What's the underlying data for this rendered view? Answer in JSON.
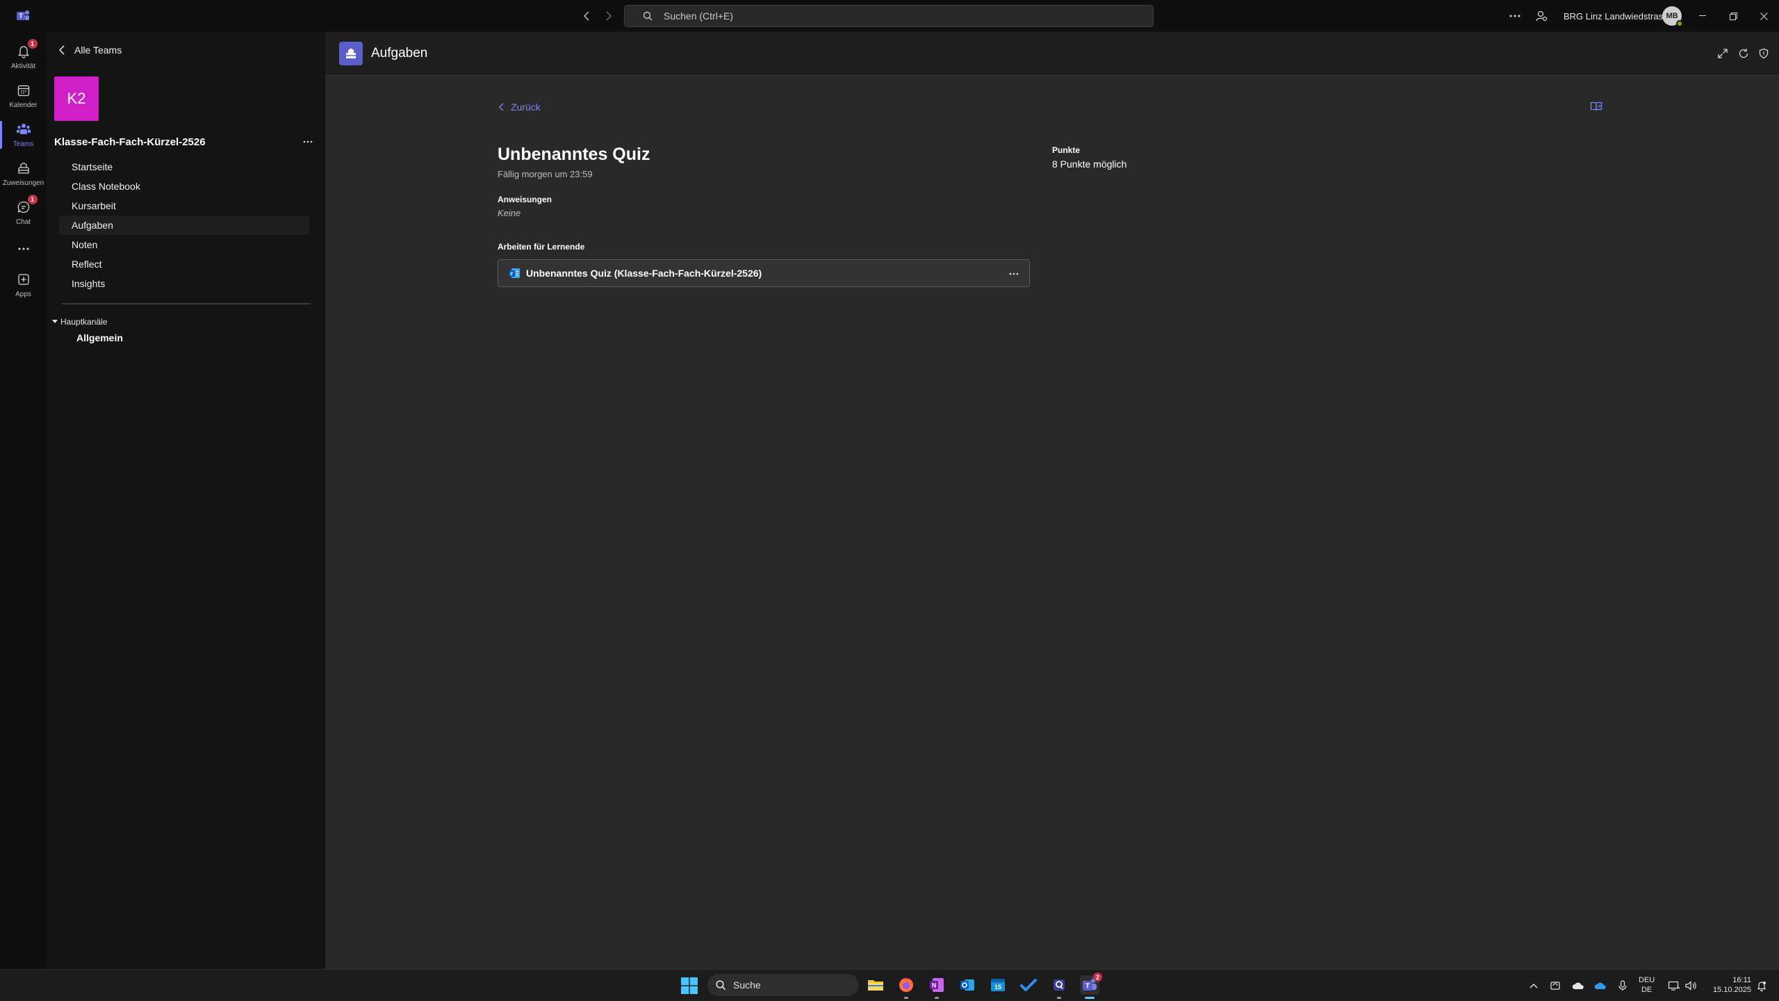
{
  "titlebar": {
    "search_placeholder": "Suchen (Ctrl+E)",
    "org_name": "BRG Linz Landwiedstrasse",
    "avatar_initials": "MB"
  },
  "rail": {
    "items": [
      {
        "label": "Aktivität",
        "icon": "bell-icon",
        "badge": "1"
      },
      {
        "label": "Kalender",
        "icon": "calendar-icon"
      },
      {
        "label": "Teams",
        "icon": "teams-icon",
        "active": true
      },
      {
        "label": "Zuweisungen",
        "icon": "assignments-icon"
      },
      {
        "label": "Chat",
        "icon": "chat-icon",
        "badge": "1"
      },
      {
        "label": "Apps",
        "icon": "apps-icon"
      }
    ]
  },
  "team": {
    "back_label": "Alle Teams",
    "tile_initials": "K2",
    "tile_color": "#d11fc7",
    "name": "Klasse-Fach-Fach-Kürzel-2526",
    "nav": [
      "Startseite",
      "Class Notebook",
      "Kursarbeit",
      "Aufgaben",
      "Noten",
      "Reflect",
      "Insights"
    ],
    "selected_nav": "Aufgaben",
    "channels_header": "Hauptkanäle",
    "channel": "Allgemein"
  },
  "app": {
    "title": "Aufgaben",
    "accent": "#5b5fc7"
  },
  "assignment": {
    "back_label": "Zurück",
    "title": "Unbenanntes Quiz",
    "due": "Fällig morgen um 23:59",
    "instructions_label": "Anweisungen",
    "instructions_value": "Keine",
    "work_label": "Arbeiten für Lernende",
    "work_item": "Unbenanntes Quiz (Klasse-Fach-Fach-Kürzel-2526)",
    "points_label": "Punkte",
    "points_value": "8 Punkte möglich"
  },
  "taskbar": {
    "search_placeholder": "Suche",
    "teams_badge": "2",
    "lang_top": "DEU",
    "lang_bottom": "DE",
    "time": "16:11",
    "date": "15.10.2025"
  }
}
